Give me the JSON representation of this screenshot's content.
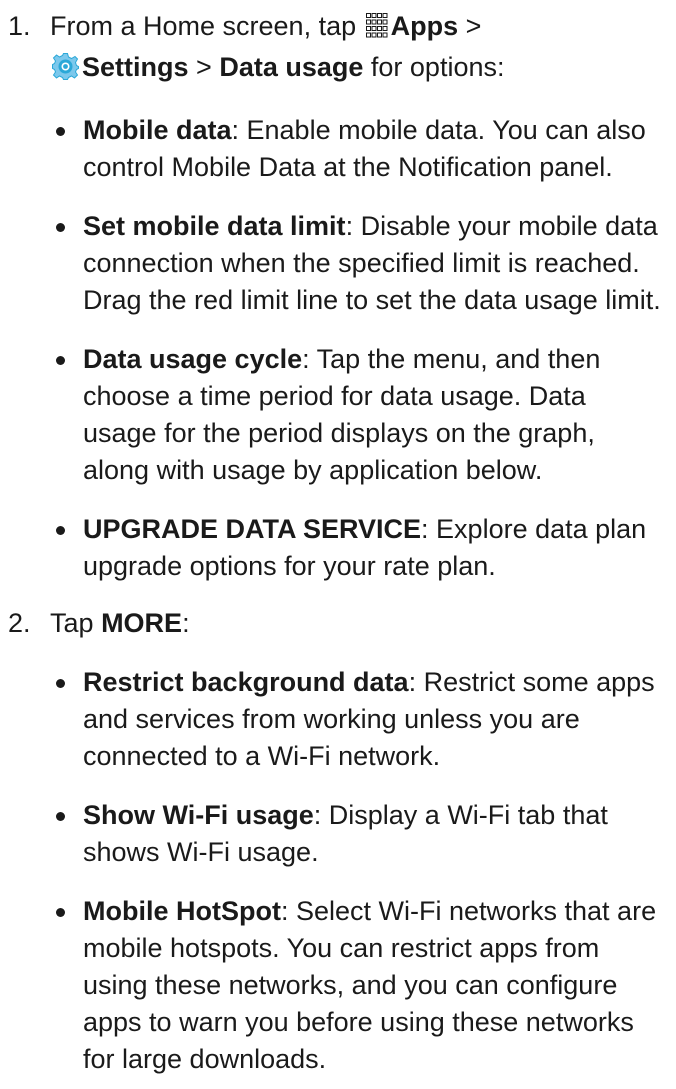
{
  "steps": [
    {
      "number": "1.",
      "line1_before": "From a Home screen, tap",
      "line1_icon": "apps-grid-icon",
      "apps_label": "Apps",
      "separator": ">",
      "settings_icon": "settings-gear-icon",
      "settings_label": "Settings",
      "data_usage_label": "Data usage",
      "line2_after": "for options:",
      "bullets": [
        {
          "term": "Mobile data",
          "desc": ": Enable mobile data. You can also control Mobile Data at the Notification panel."
        },
        {
          "term": "Set mobile data limit",
          "desc": ": Disable your mobile data connection when the specified limit is reached. Drag the red limit line to set the data usage limit."
        },
        {
          "term": "Data usage cycle",
          "desc": ": Tap the menu, and then choose a time period for data usage. Data usage for the period displays on the graph, along with usage by application below."
        },
        {
          "term": "UPGRADE DATA SERVICE",
          "desc": ": Explore data plan upgrade options for your rate plan."
        }
      ]
    },
    {
      "number": "2.",
      "before": "Tap",
      "more_label": "MORE",
      "after": ":",
      "bullets": [
        {
          "term": "Restrict background data",
          "desc": ": Restrict some apps and services from working unless you are connected to a Wi-Fi network."
        },
        {
          "term": "Show Wi-Fi usage",
          "desc": ": Display a Wi-Fi tab that shows Wi-Fi usage."
        },
        {
          "term": "Mobile HotSpot",
          "desc": ": Select Wi-Fi networks that are mobile hotspots. You can restrict apps from using these networks, and you can configure apps to warn you before using these networks for large downloads."
        }
      ]
    }
  ],
  "colors": {
    "text": "#1a1a1a",
    "settings_icon": "#2ba8d8"
  }
}
